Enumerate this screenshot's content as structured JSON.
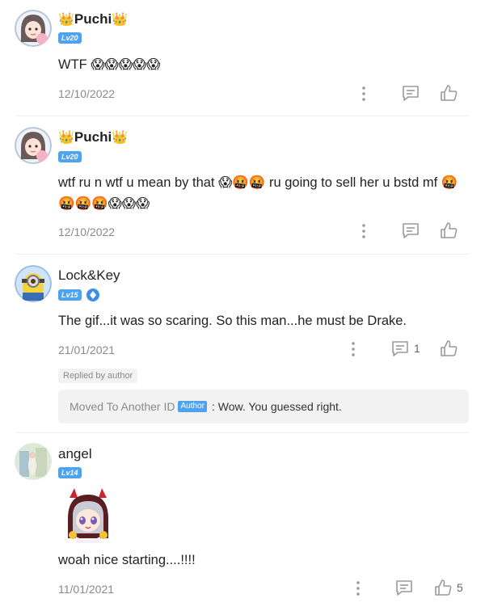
{
  "comments": [
    {
      "username": "Puchi",
      "crown_left": "👑",
      "crown_right": "👑",
      "level": "Lv20",
      "text": "WTF 😱😱😱😱😱",
      "date": "12/10/2022"
    },
    {
      "username": "Puchi",
      "crown_left": "👑",
      "crown_right": "👑",
      "level": "Lv20",
      "text": "wtf ru n wtf u mean by that 😱🤬🤬 ru going to sell her u bstd mf 🤬🤬🤬🤬😱😱😱",
      "date": "12/10/2022"
    },
    {
      "username": "Lock&Key",
      "level": "Lv15",
      "text": "The gif...it was so scaring. So this man...he must be Drake.",
      "date": "21/01/2021",
      "comment_count": "1",
      "replied_tag": "Replied by author",
      "reply": {
        "name": "Moved To Another ID",
        "badge": "Author",
        "text": ": Wow. You guessed right."
      }
    },
    {
      "username": "angel",
      "level": "Lv14",
      "text": "woah nice starting....!!!!",
      "date": "11/01/2021",
      "like_count": "5"
    }
  ],
  "icons": {
    "more": "more-vertical-icon",
    "comment": "comment-icon",
    "like": "thumbs-up-icon",
    "verified": "diamond-icon"
  },
  "colors": {
    "level_badge": "#4fa3ee",
    "secondary_text": "#8a8a8a",
    "reply_bg": "#f2f2f2"
  }
}
